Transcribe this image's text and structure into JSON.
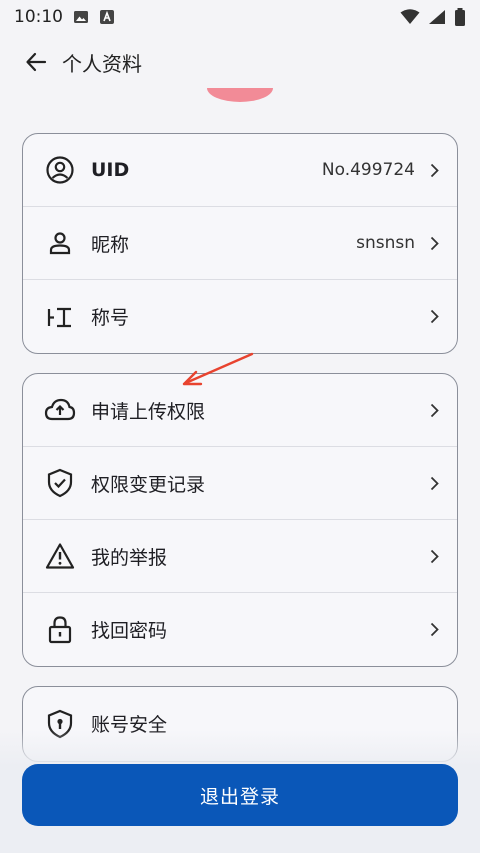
{
  "status_bar": {
    "time": "10:10"
  },
  "header": {
    "title": "个人资料"
  },
  "profile_card": [
    {
      "label": "UID",
      "value": "No.499724",
      "icon": "user-circle-icon"
    },
    {
      "label": "昵称",
      "value": "snsnsn",
      "icon": "person-icon"
    },
    {
      "label": "称号",
      "value": "",
      "icon": "title-icon"
    }
  ],
  "actions_card": [
    {
      "label": "申请上传权限",
      "icon": "cloud-upload-icon"
    },
    {
      "label": "权限变更记录",
      "icon": "shield-check-icon"
    },
    {
      "label": "我的举报",
      "icon": "warning-icon"
    },
    {
      "label": "找回密码",
      "icon": "lock-icon"
    }
  ],
  "security_card": [
    {
      "label": "账号安全",
      "icon": "shield-keyhole-icon"
    }
  ],
  "logout_label": "退出登录",
  "colors": {
    "accent": "#0a57b8",
    "annotation_arrow": "#e8432f",
    "avatar": "#f28b97"
  }
}
